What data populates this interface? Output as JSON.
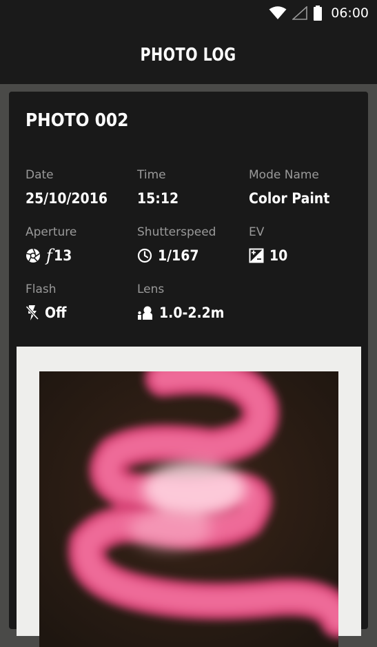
{
  "status_bar": {
    "time": "06:00",
    "icons": [
      "wifi-icon",
      "signal-icon",
      "battery-icon"
    ]
  },
  "app_bar": {
    "title": "PHOTO LOG"
  },
  "card": {
    "title": "PHOTO 002",
    "fields": {
      "date": {
        "label": "Date",
        "value": "25/10/2016"
      },
      "time": {
        "label": "Time",
        "value": "15:12"
      },
      "mode": {
        "label": "Mode Name",
        "value": "Color Paint"
      },
      "aperture": {
        "label": "Aperture",
        "symbol": "f",
        "value": "13",
        "icon": "aperture-icon"
      },
      "shutter": {
        "label": "Shutterspeed",
        "value": "1/167",
        "icon": "clock-icon"
      },
      "ev": {
        "label": "EV",
        "value": "10",
        "icon": "exposure-icon"
      },
      "flash": {
        "label": "Flash",
        "value": "Off",
        "icon": "flash-off-icon"
      },
      "lens": {
        "label": "Lens",
        "value": "1.0-2.2m",
        "icon": "lens-distance-icon"
      }
    }
  },
  "colors": {
    "background": "#4a4a48",
    "bar": "#1a1a1a",
    "card": "#191919",
    "label": "#9a9a9a",
    "text": "#ffffff",
    "photo_frame": "#eeeeec",
    "photo_subject": "#e0507f"
  }
}
